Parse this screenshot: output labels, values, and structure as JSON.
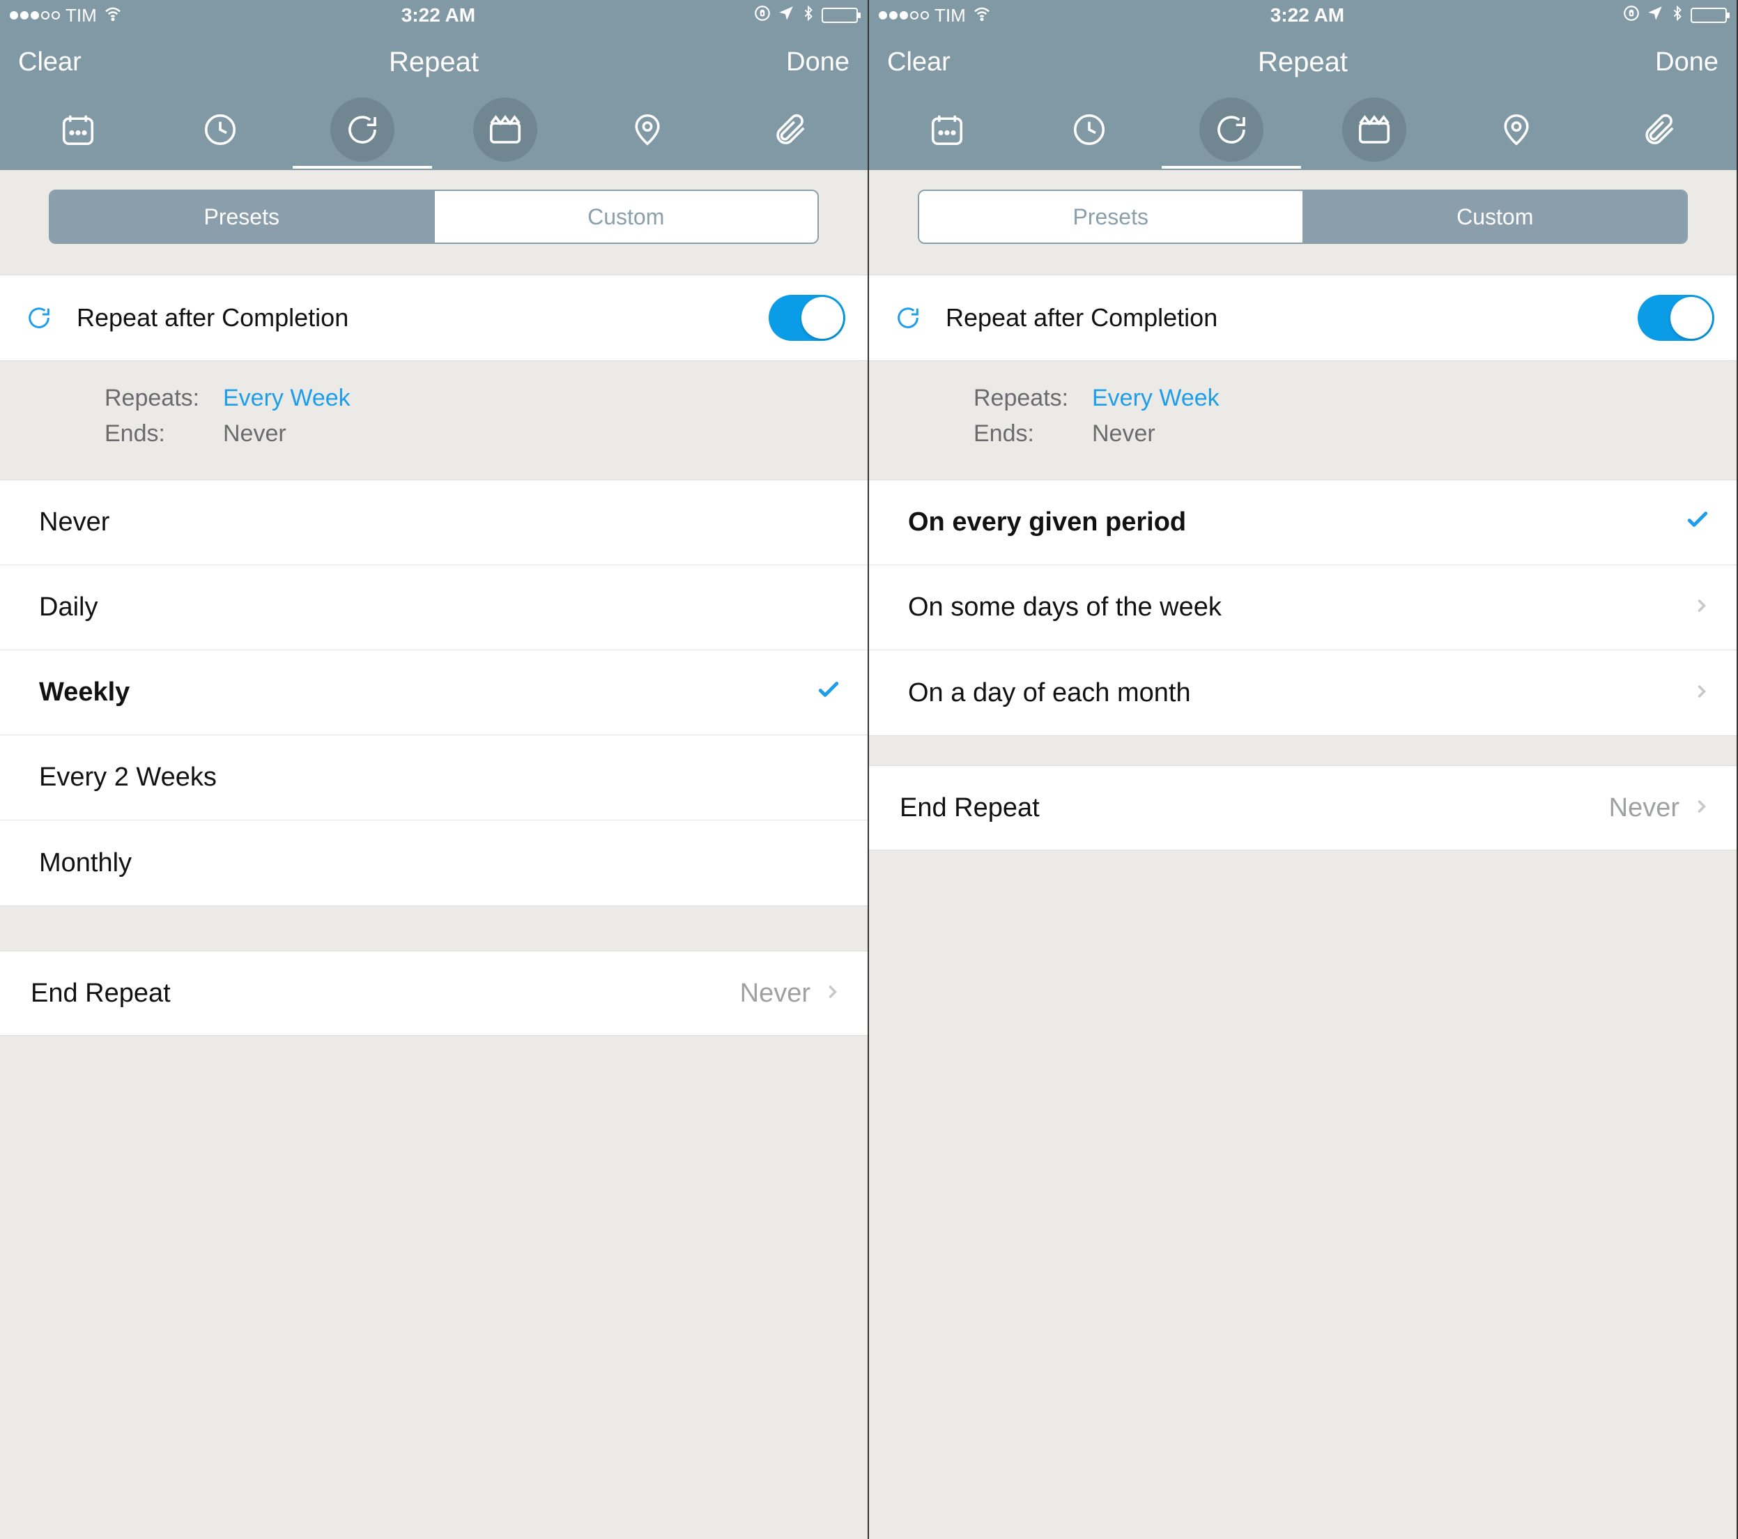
{
  "statusbar": {
    "carrier": "TIM",
    "time": "3:22 AM"
  },
  "nav": {
    "left": "Clear",
    "title": "Repeat",
    "right": "Done"
  },
  "segments": {
    "presets": "Presets",
    "custom": "Custom"
  },
  "toggle": {
    "label": "Repeat after Completion",
    "on": true
  },
  "summary": {
    "repeats_key": "Repeats:",
    "repeats_val": "Every Week",
    "ends_key": "Ends:",
    "ends_val": "Never"
  },
  "presets_list": [
    {
      "label": "Never",
      "selected": false
    },
    {
      "label": "Daily",
      "selected": false
    },
    {
      "label": "Weekly",
      "selected": true
    },
    {
      "label": "Every 2 Weeks",
      "selected": false
    },
    {
      "label": "Monthly",
      "selected": false
    }
  ],
  "custom_list": [
    {
      "label": "On every given period",
      "type": "check"
    },
    {
      "label": "On some days of the week",
      "type": "chevron"
    },
    {
      "label": "On a day of each month",
      "type": "chevron"
    }
  ],
  "end_repeat": {
    "label": "End Repeat",
    "value": "Never"
  },
  "tabs": [
    "calendar",
    "clock",
    "repeat",
    "clip",
    "location",
    "attach"
  ],
  "colors": {
    "header": "#8099A5",
    "accent": "#1E9DE9",
    "toggle": "#0A9CE6",
    "bg": "#EBEAE7"
  }
}
